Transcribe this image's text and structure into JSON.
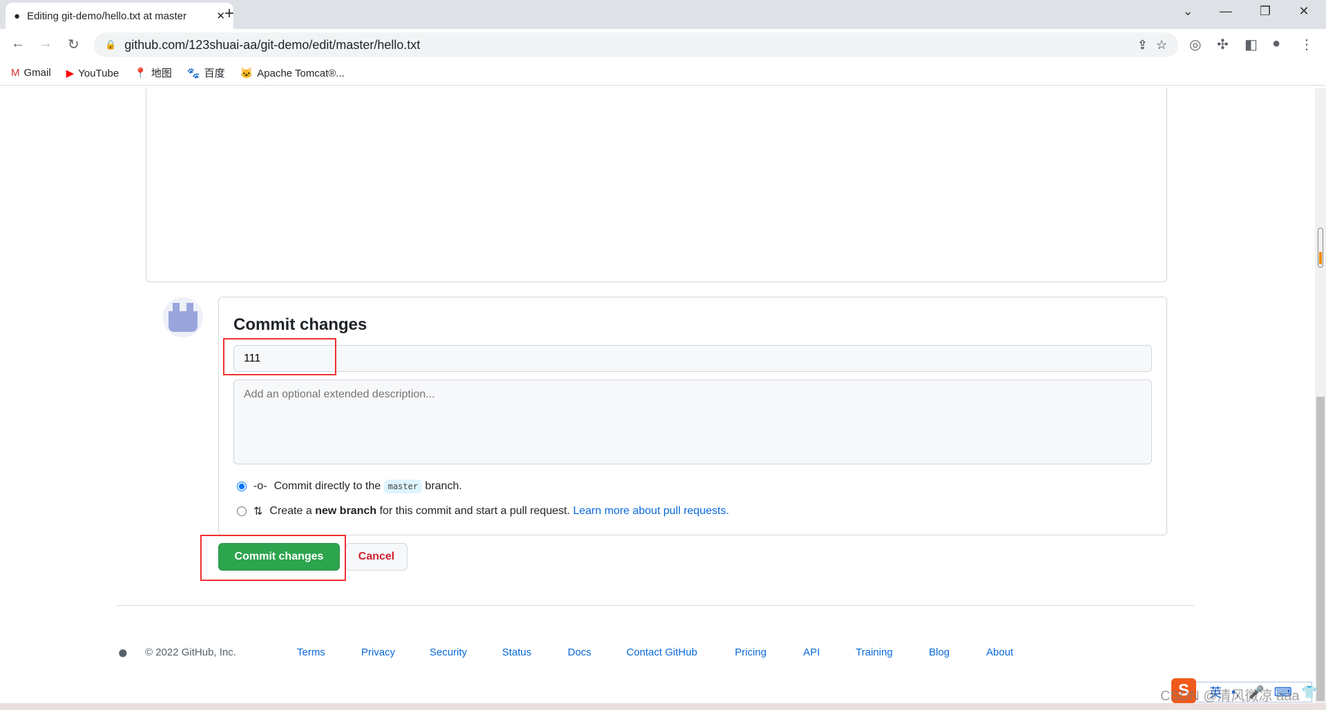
{
  "browser": {
    "tab_title": "Editing git-demo/hello.txt at master",
    "url": "github.com/123shuai-aa/git-demo/edit/master/hello.txt",
    "bookmarks": [
      {
        "label": "Gmail",
        "icon": "gmail-icon"
      },
      {
        "label": "YouTube",
        "icon": "youtube-icon"
      },
      {
        "label": "地图",
        "icon": "maps-icon"
      },
      {
        "label": "百度",
        "icon": "baidu-icon"
      },
      {
        "label": "Apache Tomcat®...",
        "icon": "tomcat-icon"
      }
    ]
  },
  "commit": {
    "heading": "Commit changes",
    "summary_value": "111",
    "description_placeholder": "Add an optional extended description...",
    "option_direct_prefix": "Commit directly to the",
    "branch": "master",
    "option_direct_suffix": "branch.",
    "option_new_prefix": "Create a",
    "option_new_bold": "new branch",
    "option_new_suffix": "for this commit and start a pull request.",
    "learn_more": "Learn more about pull requests.",
    "selected_option": "direct",
    "commit_button": "Commit changes",
    "cancel_button": "Cancel"
  },
  "footer": {
    "copyright": "© 2022 GitHub, Inc.",
    "links": [
      "Terms",
      "Privacy",
      "Security",
      "Status",
      "Docs",
      "Contact GitHub",
      "Pricing",
      "API",
      "Training",
      "Blog",
      "About"
    ]
  },
  "ime": {
    "lang": "英"
  },
  "watermark": "CSDN @清风微凉 aaa",
  "colors": {
    "primary_button": "#2da44e",
    "cancel_text": "#cf222e",
    "link": "#0969da",
    "highlight": "#f03030"
  }
}
